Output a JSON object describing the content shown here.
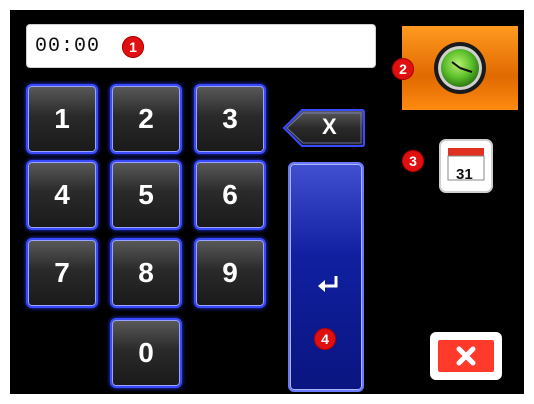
{
  "time_input": {
    "value": "00:00"
  },
  "badges": [
    "1",
    "2",
    "3",
    "4"
  ],
  "keypad": {
    "keys": [
      "1",
      "2",
      "3",
      "4",
      "5",
      "6",
      "7",
      "8",
      "9",
      "0"
    ],
    "backspace_label": "X"
  },
  "icons": {
    "clock": "clock-icon",
    "calendar": "calendar-icon",
    "calendar_day": "31",
    "enter": "enter-arrow-icon",
    "cancel": "close-icon"
  },
  "colors": {
    "accent": "#3a4bff",
    "enter_button": "#1020a0",
    "clock_button": "#ff8a10",
    "badge": "#e01010",
    "cancel": "#ff3a2a"
  }
}
